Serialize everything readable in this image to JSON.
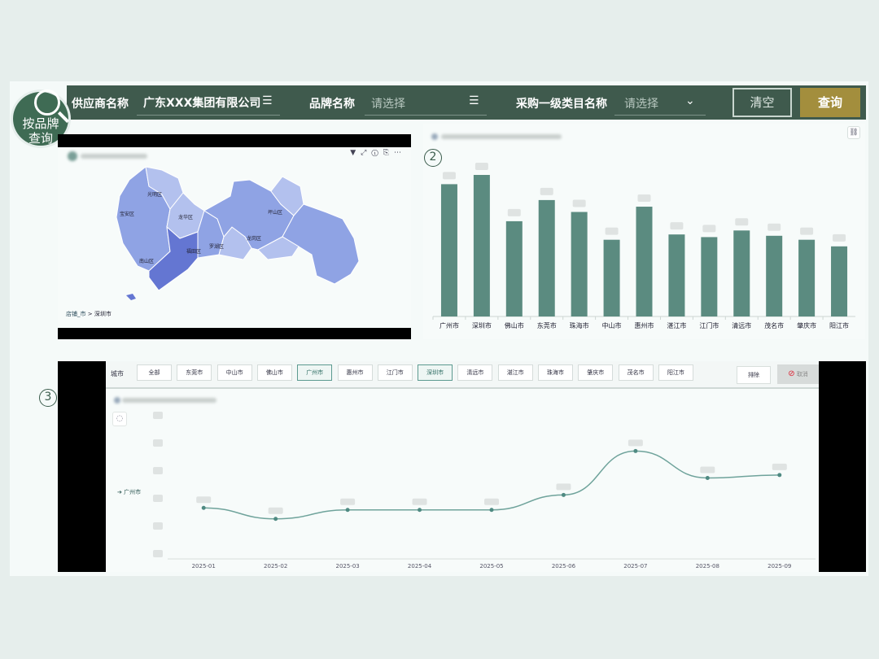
{
  "filters": {
    "supplier_label": "供应商名称",
    "supplier_value": "广东XXX集团有限公司",
    "brand_label": "品牌名称",
    "brand_placeholder": "请选择",
    "category_label": "采购一级类目名称",
    "category_placeholder": "请选择",
    "clear_label": "清空",
    "query_label": "查询",
    "list_icon": "list-filter-icon",
    "chevron_icon": "chevron-down-icon"
  },
  "badge": {
    "line1": "按品牌",
    "line2": "查询",
    "icon": "search-icon"
  },
  "map": {
    "breadcrumb_root": "店铺_市",
    "breadcrumb_sep": ">",
    "breadcrumb_current": "深圳市",
    "districts": [
      "光明区",
      "宝安区",
      "龙华区",
      "坪山区",
      "南山区",
      "福田区",
      "龙岗区",
      "罗湖区"
    ],
    "colors": {
      "light": "#b3c1ee",
      "mid": "#8fa3e4",
      "dark": "#6476d2"
    },
    "toolbar_icons": [
      "filter-icon",
      "expand-icon",
      "info-icon",
      "export-icon",
      "more-icon"
    ]
  },
  "bar_section": {
    "number": "2",
    "link_icon": "link-icon",
    "bar_color": "#5b8b80"
  },
  "line_section": {
    "number": "3",
    "city_filter_label": "城市",
    "city_chips": [
      "全部",
      "东莞市",
      "中山市",
      "佛山市",
      "广州市",
      "惠州市",
      "江门市",
      "深圳市",
      "清远市",
      "湛江市",
      "珠海市",
      "肇庆市",
      "茂名市",
      "阳江市"
    ],
    "selected_chips": [
      "广州市",
      "深圳市"
    ],
    "exclude_label": "排除",
    "cancel_label": "取消",
    "refresh_icon": "refresh-icon",
    "legend_series": "广州市",
    "line_color": "#6fa39b"
  },
  "chart_data": [
    {
      "type": "bar",
      "categories": [
        "广州市",
        "深圳市",
        "佛山市",
        "东莞市",
        "珠海市",
        "中山市",
        "惠州市",
        "湛江市",
        "江门市",
        "清远市",
        "茂名市",
        "肇庆市",
        "阳江市"
      ],
      "values": [
        100,
        107,
        72,
        88,
        79,
        58,
        83,
        62,
        60,
        65,
        61,
        58,
        53
      ],
      "ylim": [
        0,
        115
      ],
      "grid": false
    },
    {
      "type": "line",
      "x": [
        "2025-01",
        "2025-02",
        "2025-03",
        "2025-04",
        "2025-05",
        "2025-06",
        "2025-07",
        "2025-08",
        "2025-09"
      ],
      "series": [
        {
          "name": "广州市",
          "values": [
            43,
            32,
            41,
            41,
            41,
            56,
            100,
            73,
            76
          ]
        }
      ],
      "ylim": [
        0,
        115
      ],
      "grid": false
    }
  ]
}
